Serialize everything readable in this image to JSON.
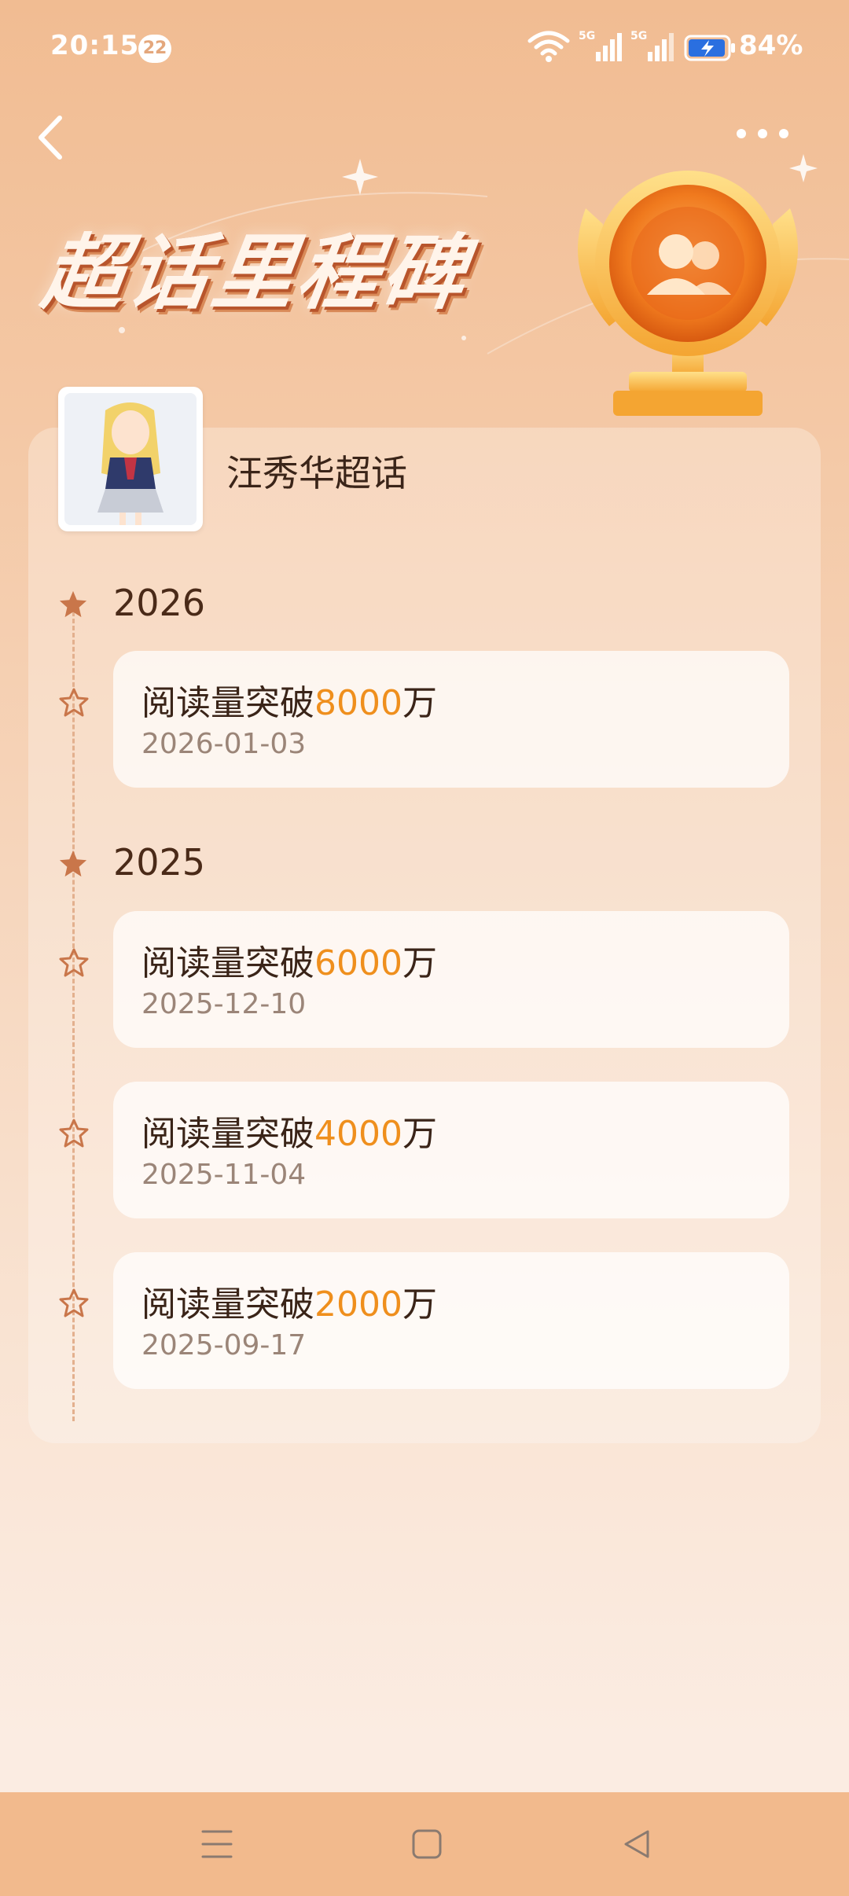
{
  "status_bar": {
    "time": "20:15",
    "notification_count": "22",
    "battery_percent": "84%",
    "icons": [
      "wifi-icon",
      "signal-5g-icon",
      "signal-5g-icon",
      "battery-charging-icon"
    ]
  },
  "header": {
    "title": "超话里程碑",
    "back_icon": "chevron-left-icon",
    "more_icon": "more-dots-icon"
  },
  "topic": {
    "name": "汪秀华超话"
  },
  "timeline": [
    {
      "year": "2026",
      "items": [
        {
          "prefix": "阅读量突破",
          "value": "8000",
          "suffix": "万",
          "date": "2026-01-03"
        }
      ]
    },
    {
      "year": "2025",
      "items": [
        {
          "prefix": "阅读量突破",
          "value": "6000",
          "suffix": "万",
          "date": "2025-12-10"
        },
        {
          "prefix": "阅读量突破",
          "value": "4000",
          "suffix": "万",
          "date": "2025-11-04"
        },
        {
          "prefix": "阅读量突破",
          "value": "2000",
          "suffix": "万",
          "date": "2025-09-17"
        }
      ]
    }
  ],
  "colors": {
    "accent": "#ef8f1d",
    "star": "#c9764a",
    "navbar": "#f2ba8d"
  },
  "nav_bar": [
    "menu-icon",
    "home-square-icon",
    "back-triangle-icon"
  ]
}
